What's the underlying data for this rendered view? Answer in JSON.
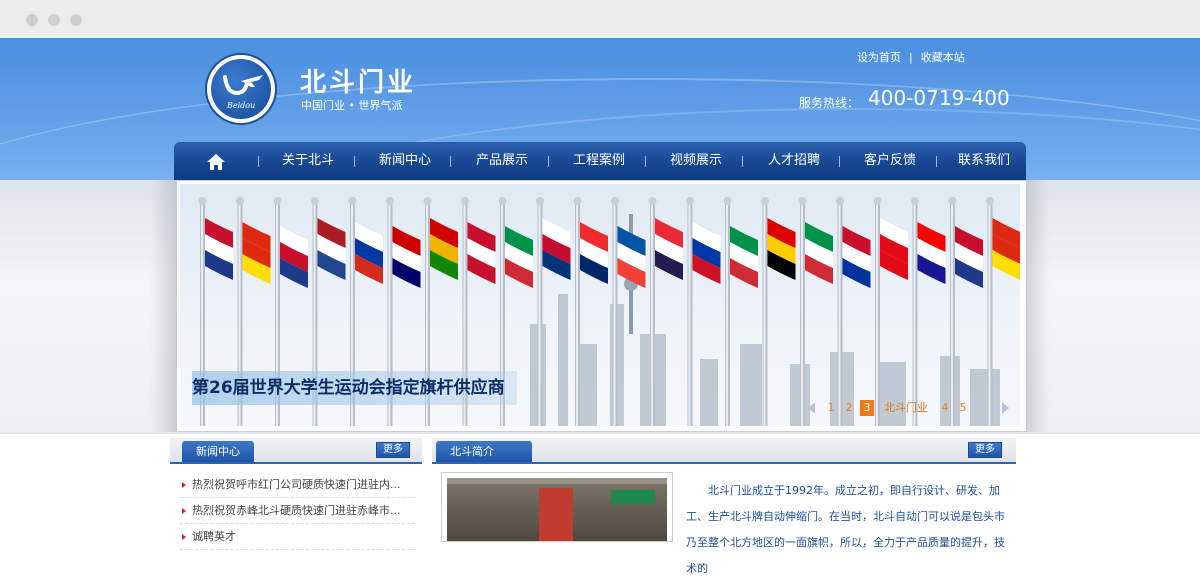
{
  "header": {
    "brand_name": "北斗门业",
    "slogan": "中国门业 • 世界气派",
    "logo_text": "Beidou",
    "top_links": [
      "设为首页",
      "收藏本站"
    ],
    "hotline_label": "服务热线：",
    "hotline_number": "400-0719-400"
  },
  "nav": {
    "home_icon": "home-icon",
    "items": [
      "关于北斗",
      "新闻中心",
      "产品展示",
      "工程案例",
      "视频展示",
      "人才招聘",
      "客户反馈",
      "联系我们"
    ]
  },
  "banner": {
    "caption": "第26届世界大学生运动会指定旗杆供应商",
    "pager": [
      "1",
      "2",
      "3",
      "北斗门业",
      "4",
      "5"
    ],
    "active_page": "3"
  },
  "news": {
    "title": "新闻中心",
    "more": "更多",
    "items": [
      "热烈祝贺呼市红门公司硬质快速门进驻内...",
      "热烈祝贺赤峰北斗硬质快速门进驻赤峰市...",
      "诚聘英才"
    ]
  },
  "intro": {
    "title": "北斗简介",
    "more": "更多",
    "text": "北斗门业成立于1992年。成立之初，即自行设计、研发、加工、生产北斗牌自动伸缩门。在当时，北斗自动门可以说是包头市乃至整个北方地区的一面旗帜，所以，全力于产品质量的提升，技术的"
  },
  "colors": {
    "nav_bg": "#16458f",
    "header_bg": "#4b8fe0",
    "pager_accent": "#f07a16"
  }
}
